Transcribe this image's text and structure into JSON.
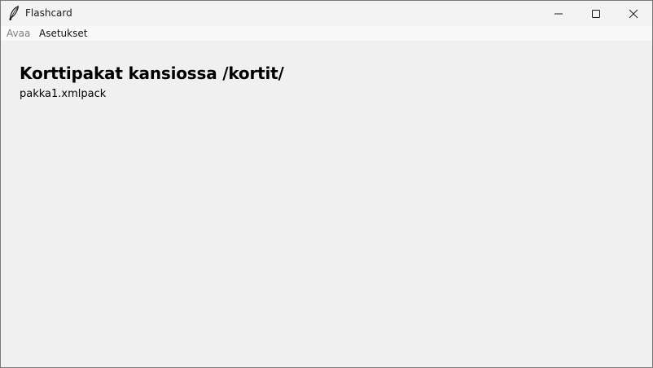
{
  "window": {
    "title": "Flashcard",
    "icon": "feather-icon",
    "controls": [
      "minimize-icon",
      "maximize-icon",
      "close-icon"
    ]
  },
  "menu": {
    "items": [
      {
        "label": "Avaa",
        "enabled": false
      },
      {
        "label": "Asetukset",
        "enabled": true
      }
    ]
  },
  "main": {
    "heading": "Korttipakat kansiossa /kortit/",
    "files": [
      "pakka1.xmlpack"
    ]
  },
  "colors": {
    "content_bg": "#f0f0f0",
    "titlebar_bg": "#f3f3f3",
    "disabled_text": "#7d7d7d"
  }
}
